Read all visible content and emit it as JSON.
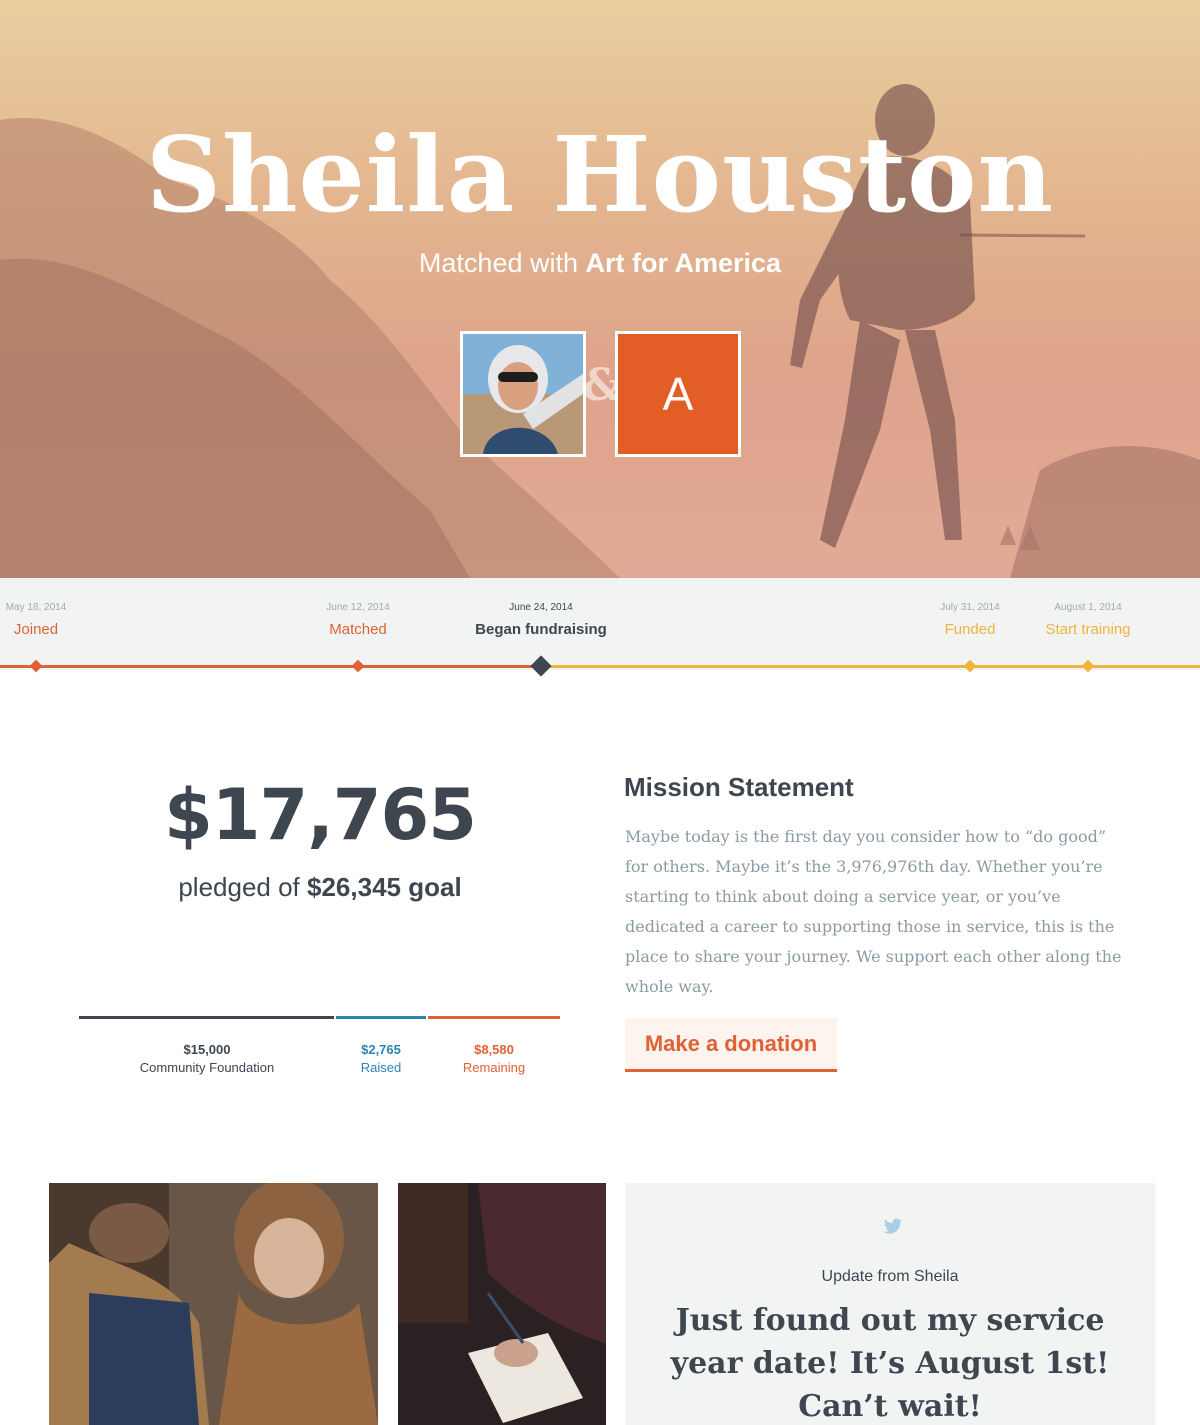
{
  "hero": {
    "name": "Sheila Houston",
    "matched_prefix": "Matched with",
    "matched_org": "Art for America",
    "ampersand": "&",
    "org_initial": "A"
  },
  "timeline": {
    "steps": [
      {
        "date": "May 18, 2014",
        "label": "Joined",
        "state": "done"
      },
      {
        "date": "June 12, 2014",
        "label": "Matched",
        "state": "done"
      },
      {
        "date": "June 24, 2014",
        "label": "Began fundraising",
        "state": "current"
      },
      {
        "date": "July 31, 2014",
        "label": "Funded",
        "state": "todo"
      },
      {
        "date": "August 1, 2014",
        "label": "Start training",
        "state": "todo"
      }
    ]
  },
  "funding": {
    "pledged_amount": "$17,765",
    "pledged_prefix": "pledged of",
    "goal": "$26,345 goal",
    "segments": [
      {
        "amount": "$15,000",
        "label": "Community Foundation",
        "color": "#3e4650"
      },
      {
        "amount": "$2,765",
        "label": "Raised",
        "color": "#2a85b5"
      },
      {
        "amount": "$8,580",
        "label": "Remaining",
        "color": "#e06234"
      }
    ]
  },
  "mission": {
    "title": "Mission Statement",
    "text": "Maybe today is the first day you consider how to “do good” for others. Maybe it’s the 3,976,976th day. Whether you’re starting to think about doing a service year, or you’ve dedicated a career to supporting those in service, this is the place to share your journey. We support each other along the whole way.",
    "donate_label": "Make a donation"
  },
  "update": {
    "icon": "twitter-icon",
    "subtitle": "Update from Sheila",
    "text": "Just found out my service year date! It’s August 1st! Can’t wait!"
  },
  "colors": {
    "accent": "#e06234",
    "pending": "#f0b43d",
    "dark": "#3e4650",
    "raised": "#2a85b5"
  }
}
